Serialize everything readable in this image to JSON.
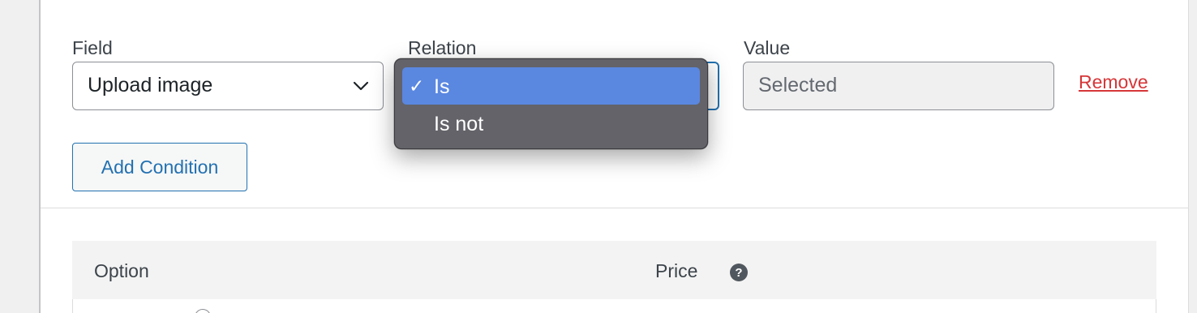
{
  "condition": {
    "field_label": "Field",
    "field_value": "Upload image",
    "relation_label": "Relation",
    "relation_options": [
      {
        "label": "Is",
        "selected": true
      },
      {
        "label": "Is not",
        "selected": false
      }
    ],
    "value_label": "Value",
    "value_value": "Selected",
    "remove_label": "Remove",
    "add_condition_label": "Add Condition"
  },
  "options_table": {
    "columns": [
      "Option",
      "Price"
    ],
    "price_help_icon": "question-circle-icon"
  },
  "colors": {
    "link_blue": "#2271b1",
    "remove_red": "#d63638",
    "selected_option": "#5a87e0",
    "popup_bg": "#636369"
  }
}
